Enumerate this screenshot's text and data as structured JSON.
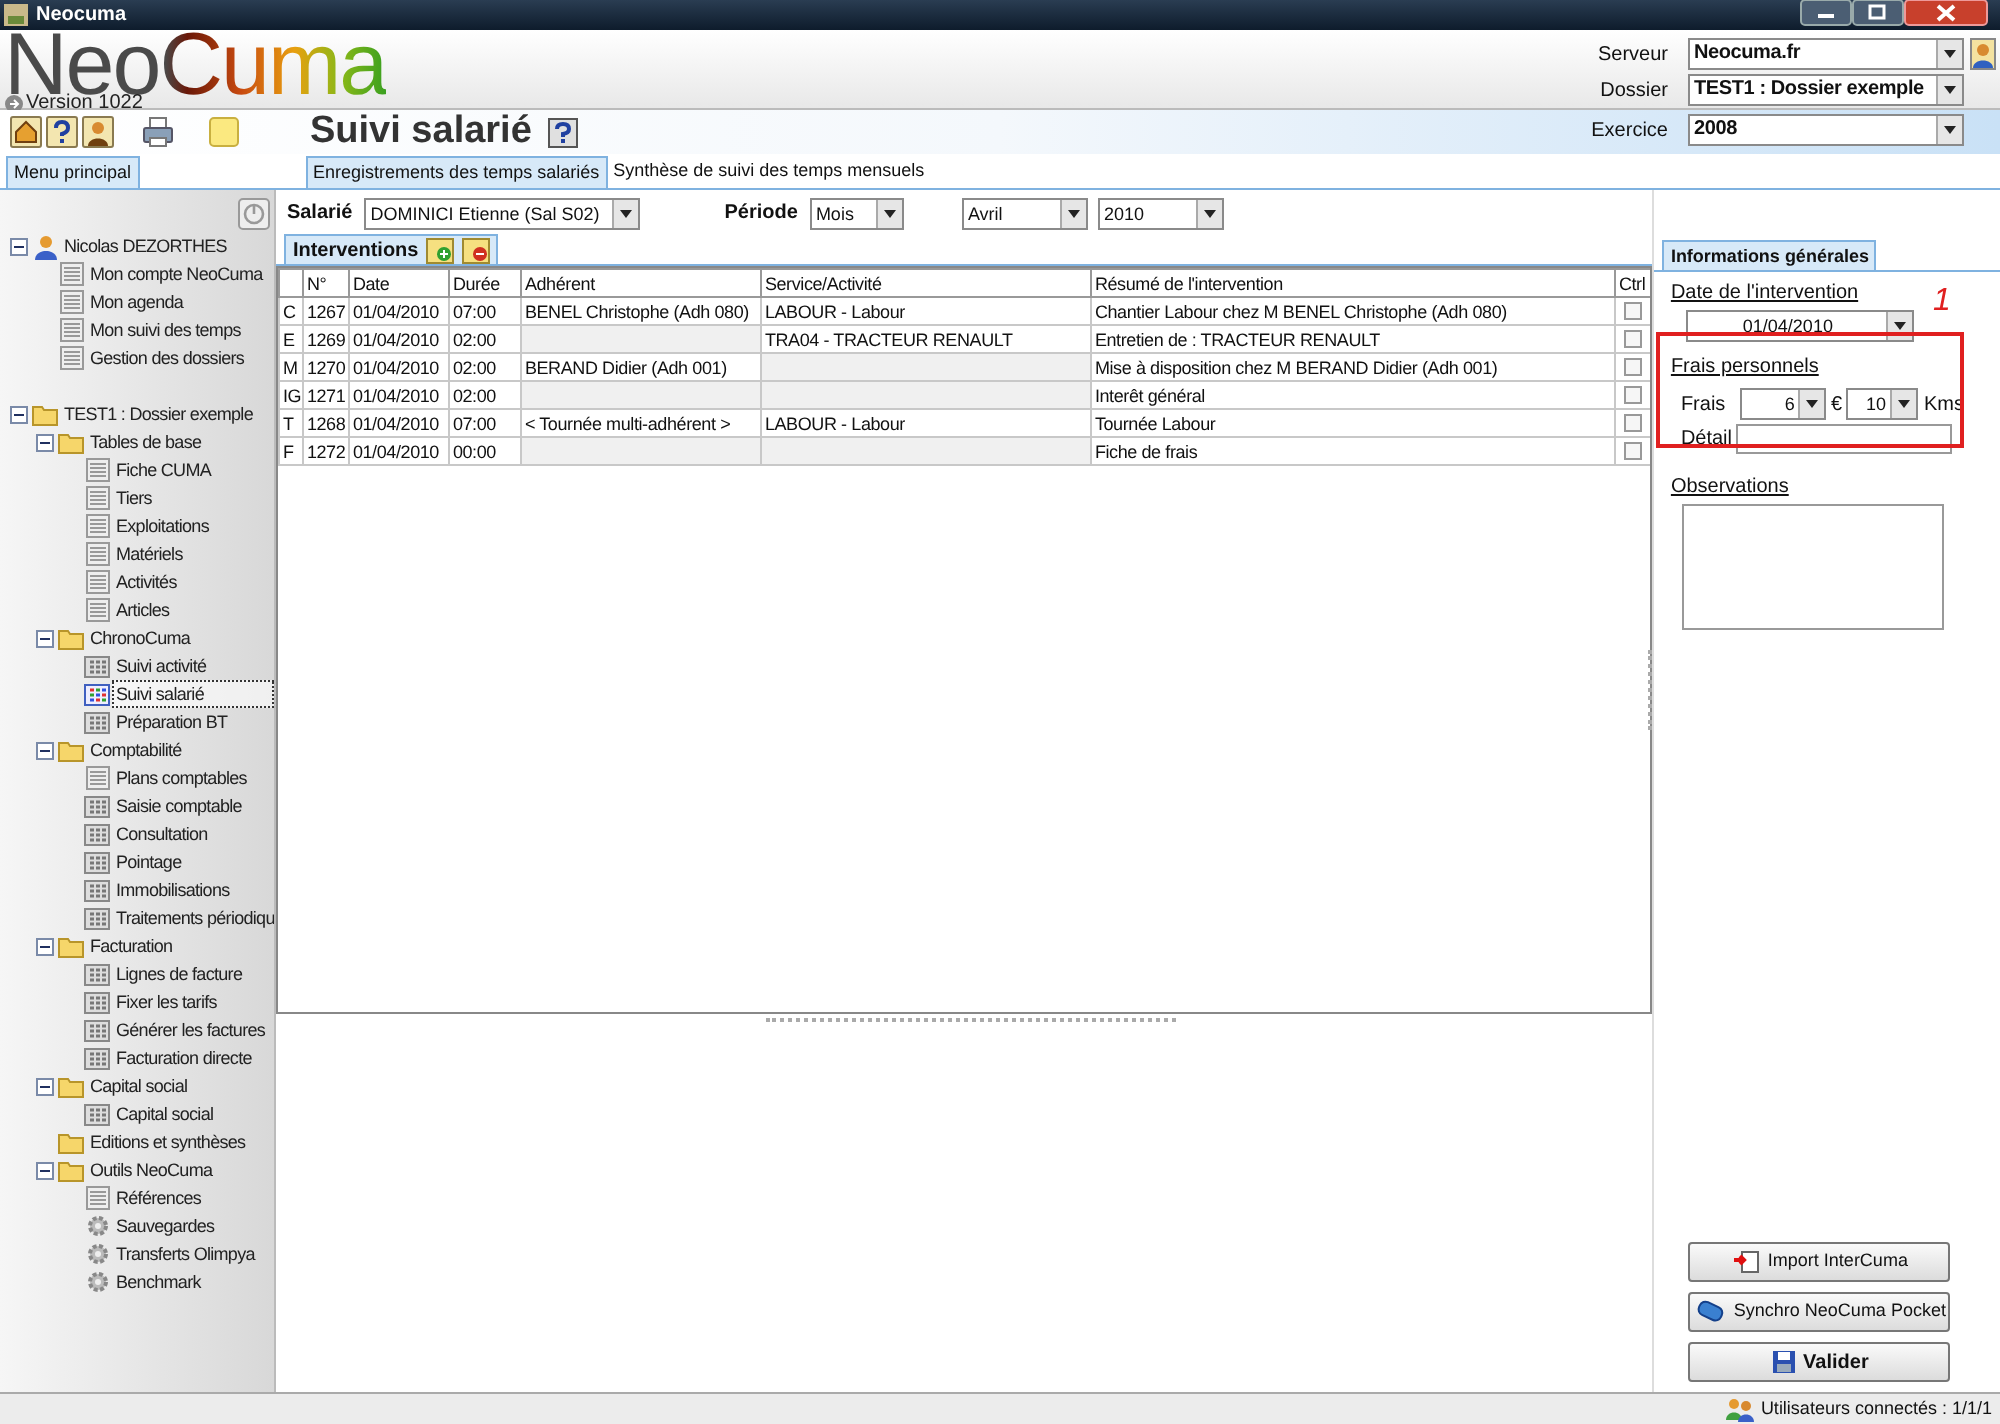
{
  "window": {
    "title": "Neocuma"
  },
  "header": {
    "logo": "NeoCuma",
    "version": "Version 1022",
    "server": {
      "label": "Serveur",
      "value": "Neocuma.fr"
    },
    "dossier": {
      "label": "Dossier",
      "value": "TEST1 : Dossier exemple"
    },
    "exercice": {
      "label": "Exercice",
      "value": "2008"
    }
  },
  "page_title": "Suivi salarié",
  "sidebar": {
    "tab": "Menu principal",
    "tree": [
      {
        "label": "Nicolas DEZORTHES",
        "kind": "user",
        "expanded": true,
        "selected": false,
        "children": [
          {
            "label": "Mon compte NeoCuma",
            "kind": "form",
            "selected": false
          },
          {
            "label": "Mon agenda",
            "kind": "form",
            "selected": false
          },
          {
            "label": "Mon suivi des temps",
            "kind": "form",
            "selected": false
          },
          {
            "label": "Gestion des dossiers",
            "kind": "form",
            "selected": false
          }
        ]
      },
      {
        "label": "TEST1 : Dossier exemple",
        "kind": "folder",
        "expanded": true,
        "selected": false,
        "children": [
          {
            "label": "Tables de base",
            "kind": "folder",
            "expanded": true,
            "selected": false,
            "children": [
              {
                "label": "Fiche CUMA",
                "kind": "form",
                "selected": false
              },
              {
                "label": "Tiers",
                "kind": "form",
                "selected": false
              },
              {
                "label": "Exploitations",
                "kind": "form",
                "selected": false
              },
              {
                "label": "Matériels",
                "kind": "form",
                "selected": false
              },
              {
                "label": "Activités",
                "kind": "form",
                "selected": false
              },
              {
                "label": "Articles",
                "kind": "form",
                "selected": false
              }
            ]
          },
          {
            "label": "ChronoCuma",
            "kind": "folder",
            "expanded": true,
            "selected": false,
            "children": [
              {
                "label": "Suivi activité",
                "kind": "grid",
                "selected": false
              },
              {
                "label": "Suivi salarié",
                "kind": "grid",
                "selected": true
              },
              {
                "label": "Préparation BT",
                "kind": "grid",
                "selected": false
              }
            ]
          },
          {
            "label": "Comptabilité",
            "kind": "folder",
            "expanded": true,
            "selected": false,
            "children": [
              {
                "label": "Plans comptables",
                "kind": "form",
                "selected": false
              },
              {
                "label": "Saisie comptable",
                "kind": "grid",
                "selected": false
              },
              {
                "label": "Consultation",
                "kind": "grid",
                "selected": false
              },
              {
                "label": "Pointage",
                "kind": "grid",
                "selected": false
              },
              {
                "label": "Immobilisations",
                "kind": "grid",
                "selected": false
              },
              {
                "label": "Traitements périodiqu",
                "kind": "grid",
                "selected": false
              }
            ]
          },
          {
            "label": "Facturation",
            "kind": "folder",
            "expanded": true,
            "selected": false,
            "children": [
              {
                "label": "Lignes de facture",
                "kind": "grid",
                "selected": false
              },
              {
                "label": "Fixer les tarifs",
                "kind": "grid",
                "selected": false
              },
              {
                "label": "Générer les factures",
                "kind": "grid",
                "selected": false
              },
              {
                "label": "Facturation directe",
                "kind": "grid",
                "selected": false
              }
            ]
          },
          {
            "label": "Capital social",
            "kind": "folder",
            "expanded": true,
            "selected": false,
            "children": [
              {
                "label": "Capital social",
                "kind": "grid",
                "selected": false
              }
            ]
          },
          {
            "label": "Editions et synthèses",
            "kind": "folder",
            "selected": false
          },
          {
            "label": "Outils NeoCuma",
            "kind": "folder",
            "expanded": true,
            "selected": false,
            "children": [
              {
                "label": "Références",
                "kind": "form",
                "selected": false
              },
              {
                "label": "Sauvegardes",
                "kind": "tool",
                "selected": false
              },
              {
                "label": "Transferts Olimpya",
                "kind": "tool",
                "selected": false
              },
              {
                "label": "Benchmark",
                "kind": "tool",
                "selected": false
              }
            ]
          }
        ]
      }
    ]
  },
  "tabs": [
    {
      "label": "Enregistrements des temps salariés",
      "selected": true
    },
    {
      "label": "Synthèse de suivi des temps mensuels",
      "selected": false
    }
  ],
  "filters": {
    "employee": {
      "label": "Salarié",
      "value": "DOMINICI Etienne (Sal S02)"
    },
    "period": {
      "label": "Période",
      "value": "Mois"
    },
    "month": {
      "value": "Avril"
    },
    "year": {
      "value": "2010"
    }
  },
  "interventions": {
    "tab": "Interventions",
    "columns": [
      "N°",
      "Date",
      "Durée",
      "Adhérent",
      "Service/Activité",
      "Résumé de l'intervention",
      "Ctrl"
    ],
    "rows": [
      {
        "type": "C",
        "number": "1267",
        "date": "01/04/2010",
        "duration": "07:00",
        "member": "BENEL Christophe (Adh 080)",
        "service": "LABOUR - Labour",
        "summary": "Chantier Labour chez M BENEL Christophe (Adh 080)",
        "checked": false
      },
      {
        "type": "E",
        "number": "1269",
        "date": "01/04/2010",
        "duration": "02:00",
        "service": "TRA04 - TRACTEUR RENAULT",
        "summary": "Entretien de : TRACTEUR RENAULT",
        "checked": false
      },
      {
        "type": "M",
        "number": "1270",
        "date": "01/04/2010",
        "duration": "02:00",
        "member": "BERAND Didier (Adh 001)",
        "summary": "Mise à disposition chez M BERAND Didier (Adh 001)",
        "checked": false
      },
      {
        "type": "IG",
        "number": "1271",
        "date": "01/04/2010",
        "duration": "02:00",
        "summary": "Interêt général",
        "checked": false
      },
      {
        "type": "T",
        "number": "1268",
        "date": "01/04/2010",
        "duration": "07:00",
        "member": "< Tournée multi-adhérent >",
        "service": "LABOUR - Labour",
        "summary": "Tournée Labour",
        "checked": false
      },
      {
        "type": "F",
        "number": "1272",
        "date": "01/04/2010",
        "duration": "00:00",
        "summary": "Fiche de frais",
        "checked": false
      }
    ]
  },
  "info_panel": {
    "tab": "Informations générales",
    "date_label": "Date de l'intervention",
    "date": "01/04/2010",
    "expenses_label": "Frais personnels",
    "frais_label": "Frais",
    "frais_value": "6",
    "currency": "€",
    "km_value": "10",
    "km_unit": "Kms",
    "detail_label": "Détail",
    "observations_label": "Observations"
  },
  "annotation": {
    "label": "1"
  },
  "buttons": [
    {
      "kind": "import",
      "label": "Import InterCuma"
    },
    {
      "kind": "sync",
      "label": "Synchro NeoCuma Pocket"
    },
    {
      "kind": "save",
      "label": "Valider"
    }
  ],
  "status_bar": {
    "text": "Utilisateurs connectés : 1/1/1"
  }
}
